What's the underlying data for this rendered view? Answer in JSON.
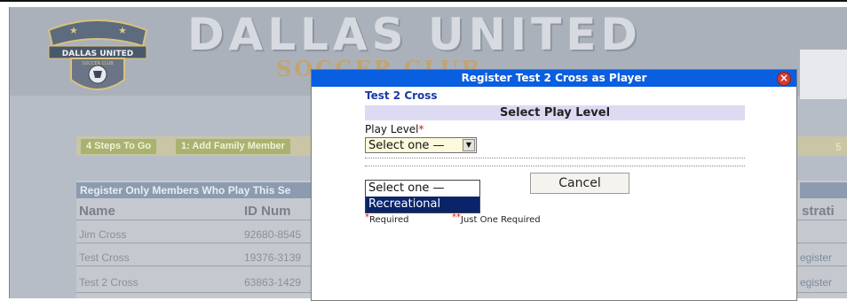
{
  "site": {
    "brand_title": "DALLAS UNITED",
    "brand_subtitle": "SOCCER CLUB",
    "logo_text": "DALLAS UNITED",
    "logo_subtext": "SOCCER CLUB"
  },
  "steps": {
    "count_label": "4 Steps To Go",
    "step1_label": "1: Add Family Member",
    "right_edge_label": "5"
  },
  "register_table": {
    "title": "Register Only Members Who Play This Se",
    "columns": [
      "Name",
      "ID Num",
      "strati"
    ],
    "rows": [
      {
        "name": "Jim Cross",
        "id": "92680-8545",
        "action": ""
      },
      {
        "name": "Test Cross",
        "id": "19376-3139",
        "action": "egister"
      },
      {
        "name": "Test 2 Cross",
        "id": "63863-1429",
        "action": "egister"
      }
    ]
  },
  "dialog": {
    "title": "Register Test 2 Cross as Player",
    "close_symbol": "×",
    "player_name": "Test 2 Cross",
    "section_heading": "Select Play Level",
    "field_label": "Play Level",
    "required_mark": "*",
    "select_value": "Select one —",
    "select_arrow": "▼",
    "options": [
      "Select one —",
      "Recreational"
    ],
    "cancel_label": "Cancel",
    "legend_required_mark": "*",
    "legend_required": "Required",
    "legend_one_mark": "**",
    "legend_one": "Just One Required"
  },
  "colors": {
    "dialog_title_bar": "#0a5ee0",
    "section_heading_bg": "#dcdbf2",
    "selected_option_bg": "#0a246a",
    "required": "#dd1111"
  }
}
